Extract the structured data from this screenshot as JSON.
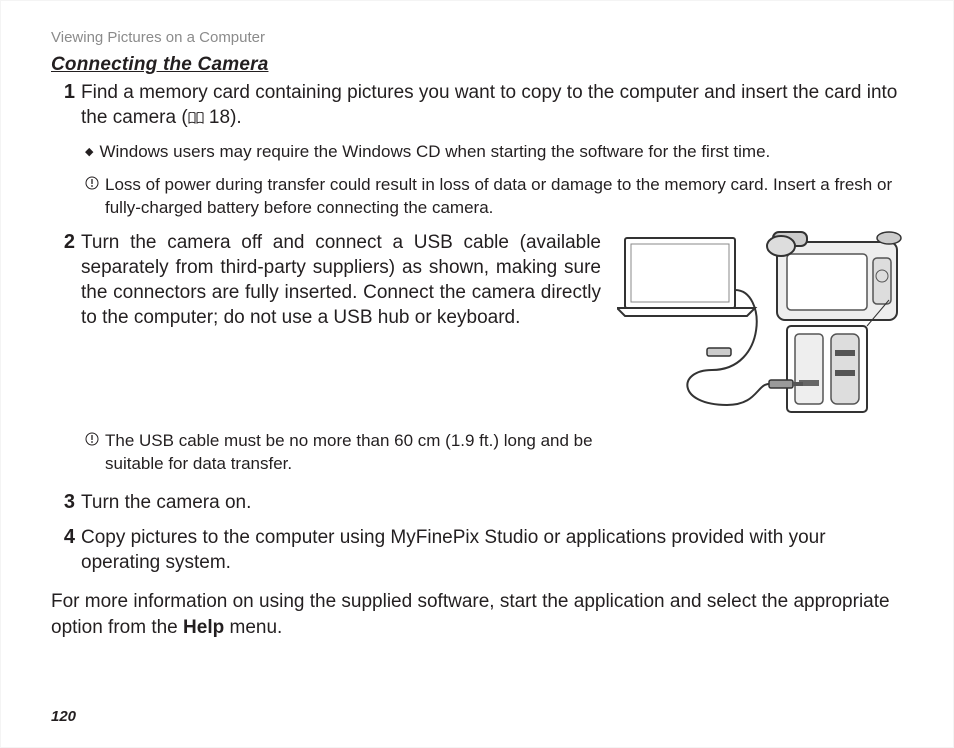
{
  "running_head": "Viewing Pictures on a Computer",
  "section_title": "Connecting the Camera",
  "page_number": "120",
  "steps": {
    "one": {
      "num": "1",
      "text_a": "Find a memory card containing pictures you want to copy to the computer and insert the card into the camera (",
      "page_ref": " 18).",
      "notes": {
        "a": "Windows users may require the Windows CD when starting the software for the first time.",
        "b": "Loss of power during transfer could result in loss of data or damage to the memory card.  Insert a fresh or fully-charged battery before connecting the camera."
      }
    },
    "two": {
      "num": "2",
      "text": "Turn the camera off and connect a USB cable (available separately from third-party suppliers) as shown, making sure the connectors are fully inserted.  Connect the camera directly to the computer; do not use a USB hub or keyboard.",
      "note": "The USB cable must be no more than 60 cm (1.9 ft.) long and be suitable for data transfer."
    },
    "three": {
      "num": "3",
      "text": "Turn the camera on."
    },
    "four": {
      "num": "4",
      "text": "Copy pictures to the computer using MyFinePix Studio or applications provided with your operating system."
    }
  },
  "closing": {
    "pre": "For more information on using the supplied software, start the application and select the appropriate option from the ",
    "bold": "Help",
    "post": " menu."
  }
}
